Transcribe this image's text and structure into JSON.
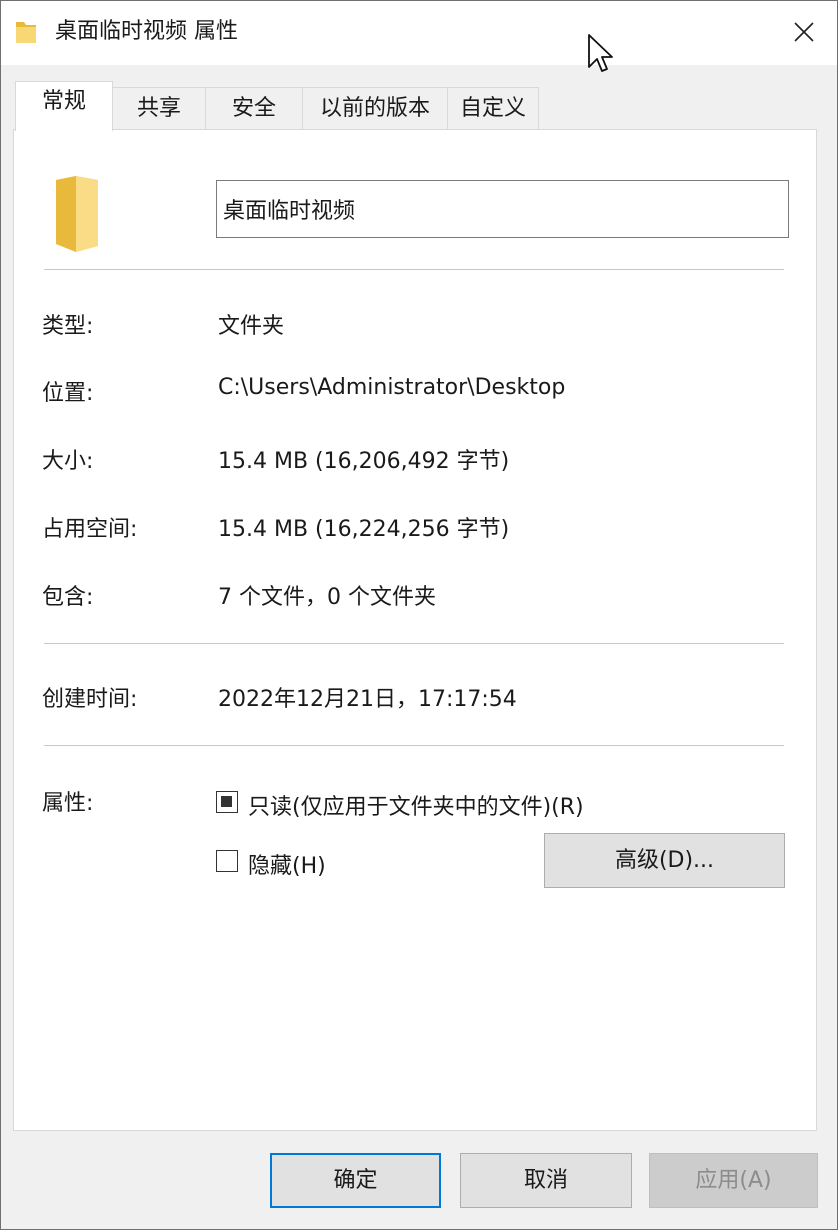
{
  "window": {
    "title": "桌面临时视频 属性"
  },
  "tabs": [
    {
      "label": "常规",
      "active": true
    },
    {
      "label": "共享",
      "active": false
    },
    {
      "label": "安全",
      "active": false
    },
    {
      "label": "以前的版本",
      "active": false
    },
    {
      "label": "自定义",
      "active": false
    }
  ],
  "general": {
    "name_value": "桌面临时视频",
    "fields": {
      "type": {
        "label": "类型:",
        "value": "文件夹"
      },
      "location": {
        "label": "位置:",
        "value": "C:\\Users\\Administrator\\Desktop"
      },
      "size": {
        "label": "大小:",
        "value": "15.4 MB (16,206,492 字节)"
      },
      "size_on_disk": {
        "label": "占用空间:",
        "value": "15.4 MB (16,224,256 字节)"
      },
      "contains": {
        "label": "包含:",
        "value": "7 个文件，0 个文件夹"
      },
      "created": {
        "label": "创建时间:",
        "value": "2022年12月21日，17:17:54"
      }
    },
    "attributes": {
      "label": "属性:",
      "readonly_label": "只读(仅应用于文件夹中的文件)(R)",
      "readonly_state": "indeterminate",
      "hidden_label": "隐藏(H)",
      "hidden_state": "unchecked",
      "advanced_label": "高级(D)..."
    }
  },
  "footer": {
    "ok_label": "确定",
    "cancel_label": "取消",
    "apply_label": "应用(A)"
  },
  "colors": {
    "folder_yellow": "#f8d775",
    "folder_shade": "#e8b93a",
    "focus_blue": "#0078d7"
  }
}
